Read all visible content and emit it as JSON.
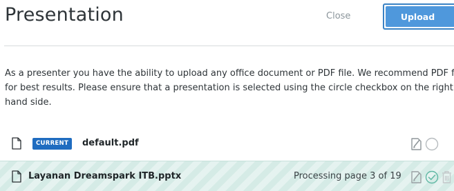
{
  "header": {
    "title": "Presentation",
    "close_label": "Close",
    "upload_label": "Upload"
  },
  "instructions": {
    "text": "As a presenter you have the ability to upload any office document or PDF file. We recommend PDF file for best results. Please ensure that a presentation is selected using the circle checkbox on the right hand side."
  },
  "files": [
    {
      "badge": "CURRENT",
      "name": "default.pdf",
      "status": "",
      "icons": [
        "file-icon",
        "download-toggle-icon",
        "select-circle-icon"
      ]
    },
    {
      "badge": "",
      "name": "Layanan Dreamspark ITB.pptx",
      "status": "Processing page 3 of 19",
      "icons": [
        "file-icon",
        "download-toggle-icon",
        "selected-check-icon",
        "trash-icon"
      ]
    }
  ],
  "colors": {
    "primary": "#4f98dc",
    "primary_border": "#3a82c4",
    "badge": "#1f6cc0",
    "processing_row": "#d5ebe6",
    "muted_text": "#8b959b",
    "icon_gray": "#b7bcbf",
    "check_green": "#5fb8a4"
  }
}
